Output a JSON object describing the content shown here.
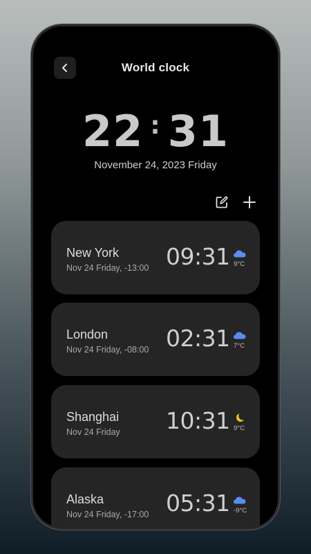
{
  "header": {
    "title": "World clock"
  },
  "main_clock": {
    "hours": "22",
    "minutes": "31",
    "date": "November 24, 2023 Friday"
  },
  "cities": [
    {
      "name": "New York",
      "sub": "Nov 24 Friday, -13:00",
      "time": "09:31",
      "weather_icon": "cloud-icon",
      "temp": "9°C"
    },
    {
      "name": "London",
      "sub": "Nov 24 Friday, -08:00",
      "time": "02:31",
      "weather_icon": "cloud-icon",
      "temp": "7°C"
    },
    {
      "name": "Shanghai",
      "sub": "Nov 24 Friday",
      "time": "10:31",
      "weather_icon": "moon-icon",
      "temp": "9°C"
    },
    {
      "name": "Alaska",
      "sub": "Nov 24 Friday, -17:00",
      "time": "05:31",
      "weather_icon": "cloud-icon",
      "temp": "-9°C"
    }
  ],
  "colors": {
    "cloud": "#5b8def",
    "moon": "#f2c21b",
    "card": "#252525"
  }
}
